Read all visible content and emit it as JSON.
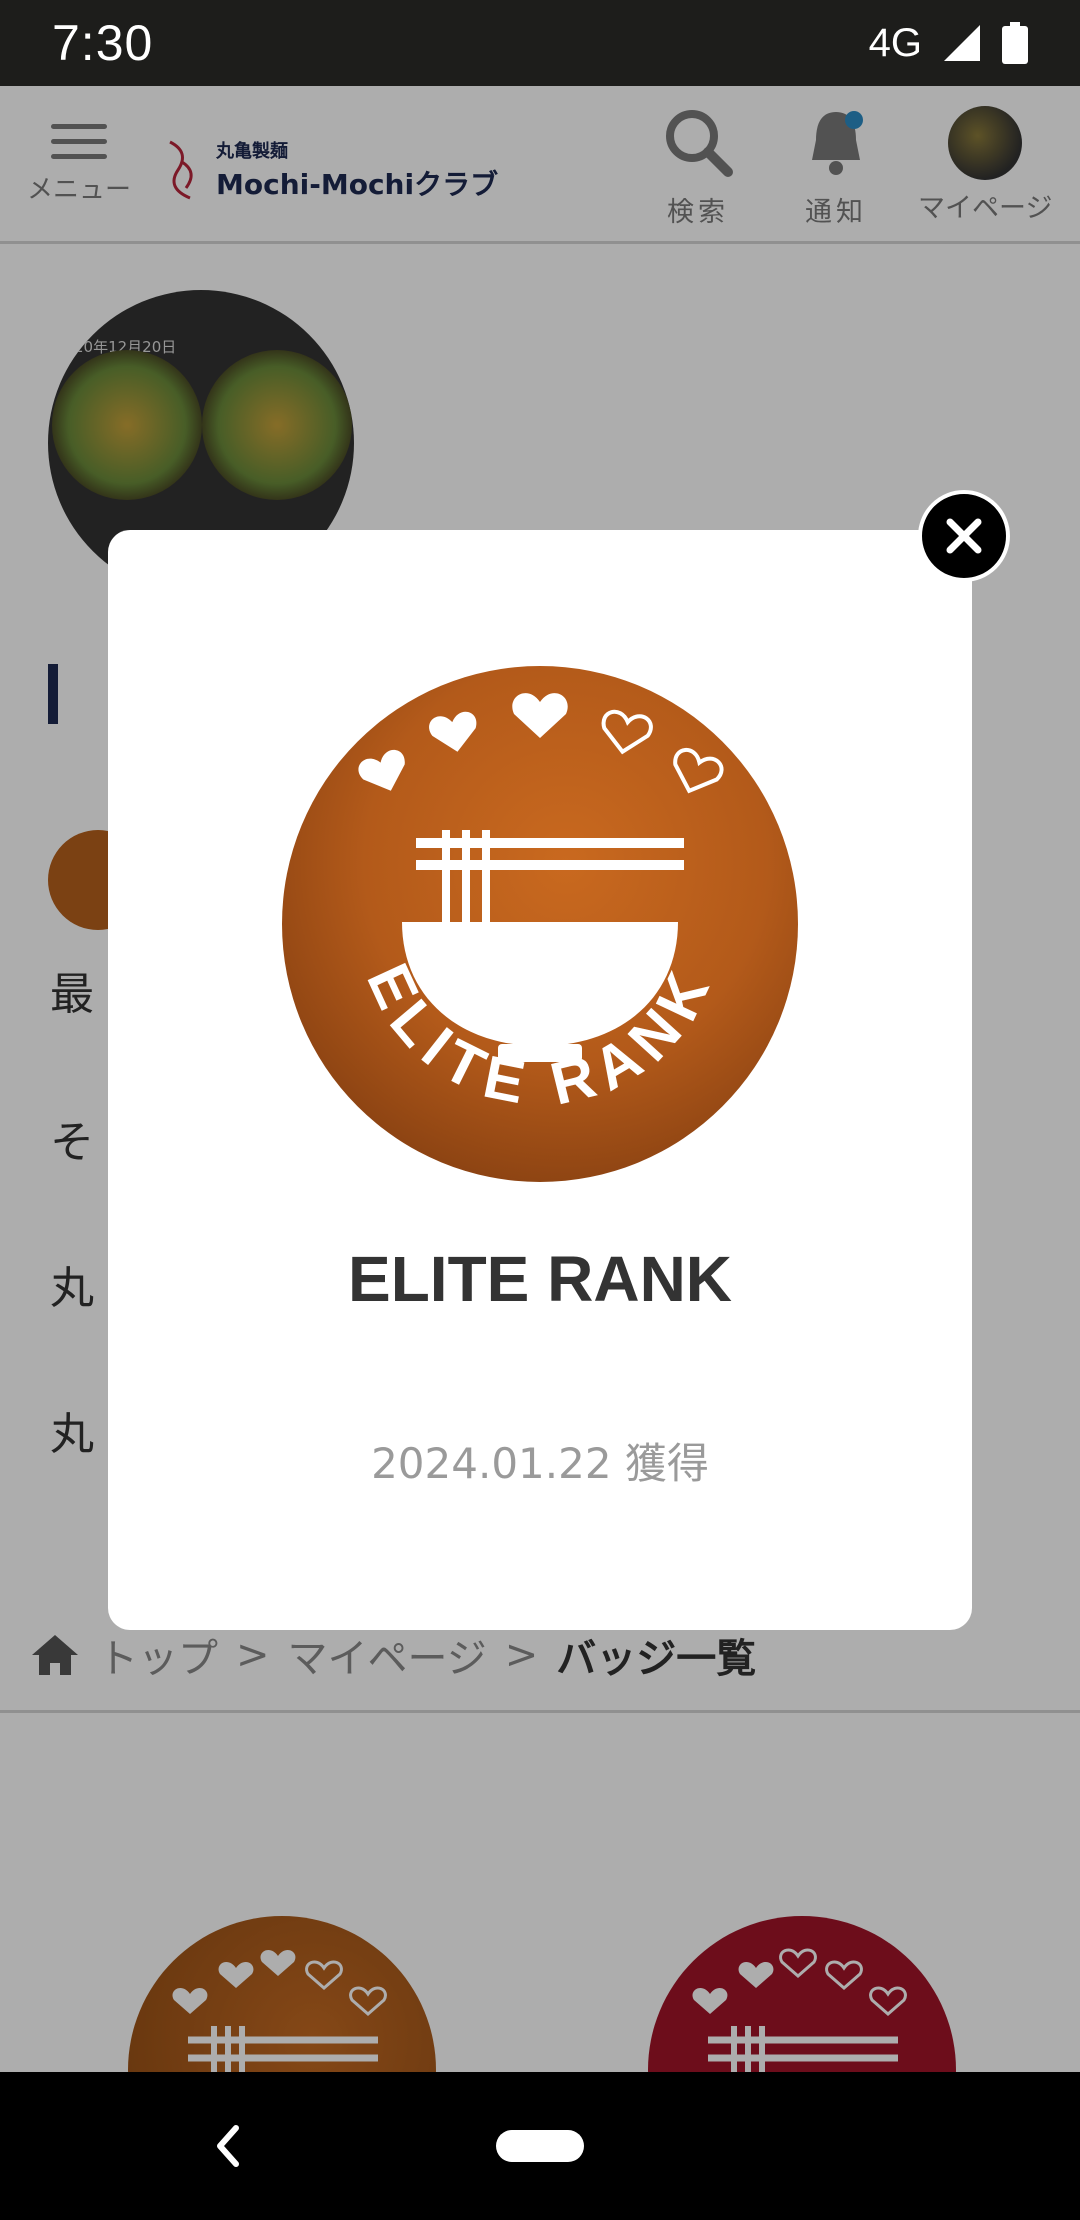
{
  "status_bar": {
    "time": "7:30",
    "network": "4G"
  },
  "header": {
    "menu_label": "メニュー",
    "logo_small": "丸亀製麺",
    "logo_main": "Mochi-Mochiクラブ",
    "search_label": "検索",
    "notify_label": "通知",
    "mypage_label": "マイページ"
  },
  "profile": {
    "photo_date": "20年12月20日"
  },
  "background_rows": [
    "最",
    "そ",
    "丸",
    "丸"
  ],
  "breadcrumb": {
    "top": "トップ",
    "mypage": "マイページ",
    "current": "バッジ一覧",
    "sep": ">"
  },
  "modal": {
    "badge_title": "ELITE RANK",
    "acquired_date": "2024.01.22 獲得",
    "badge_ring_text": "ELITE RANK"
  },
  "colors": {
    "elite": "#b5601d",
    "red_badge": "#a11428",
    "brand_navy": "#1e2a52"
  },
  "icons": [
    "menu-icon",
    "search-icon",
    "bell-icon",
    "close-icon",
    "home-icon",
    "back-icon"
  ]
}
